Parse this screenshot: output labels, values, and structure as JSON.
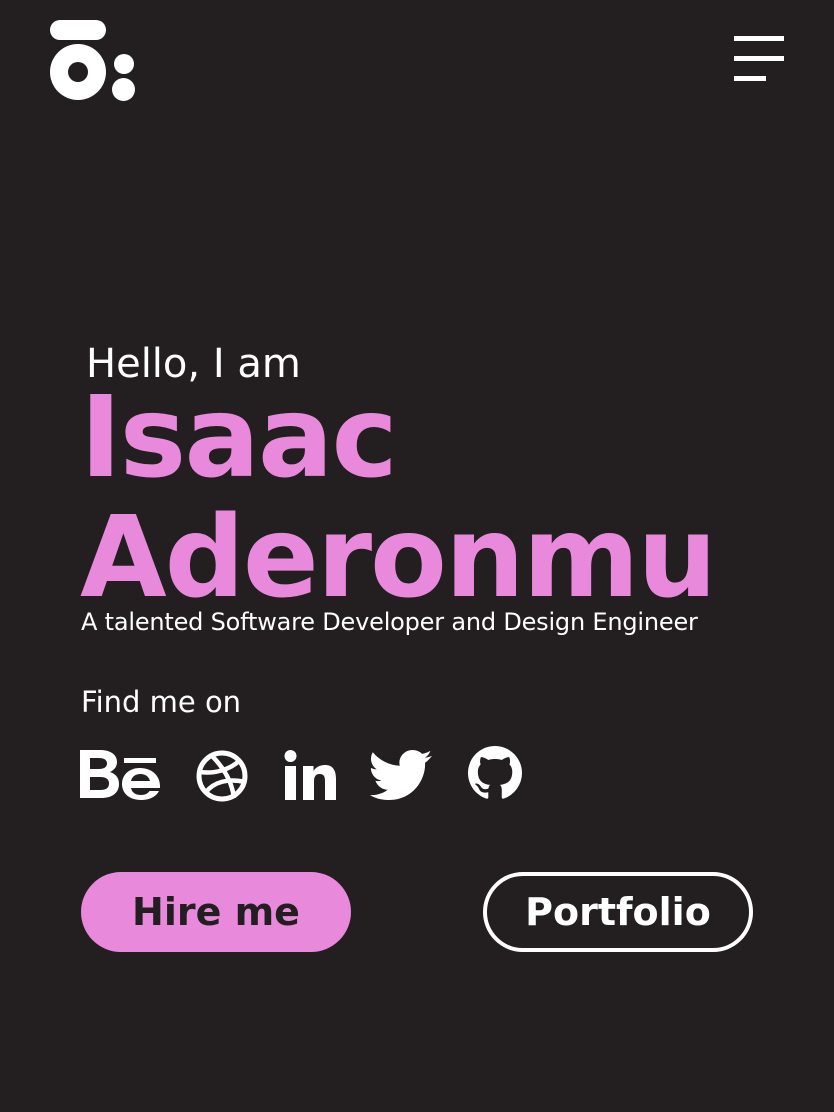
{
  "header": {
    "logo_icon": "ai-monogram-logo",
    "menu_icon": "hamburger-menu-icon"
  },
  "hero": {
    "greeting": "Hello, I am",
    "first_name": "Isaac",
    "last_name": "Aderonmu",
    "tagline": "A talented Software Developer and Design Engineer"
  },
  "social": {
    "heading": "Find me on",
    "icons": [
      "behance-icon",
      "dribbble-icon",
      "linkedin-icon",
      "twitter-icon",
      "github-icon"
    ]
  },
  "actions": {
    "hire_label": "Hire me",
    "portfolio_label": "Portfolio"
  },
  "colors": {
    "background": "#231f20",
    "accent": "#e989dc",
    "text": "#ffffff"
  }
}
